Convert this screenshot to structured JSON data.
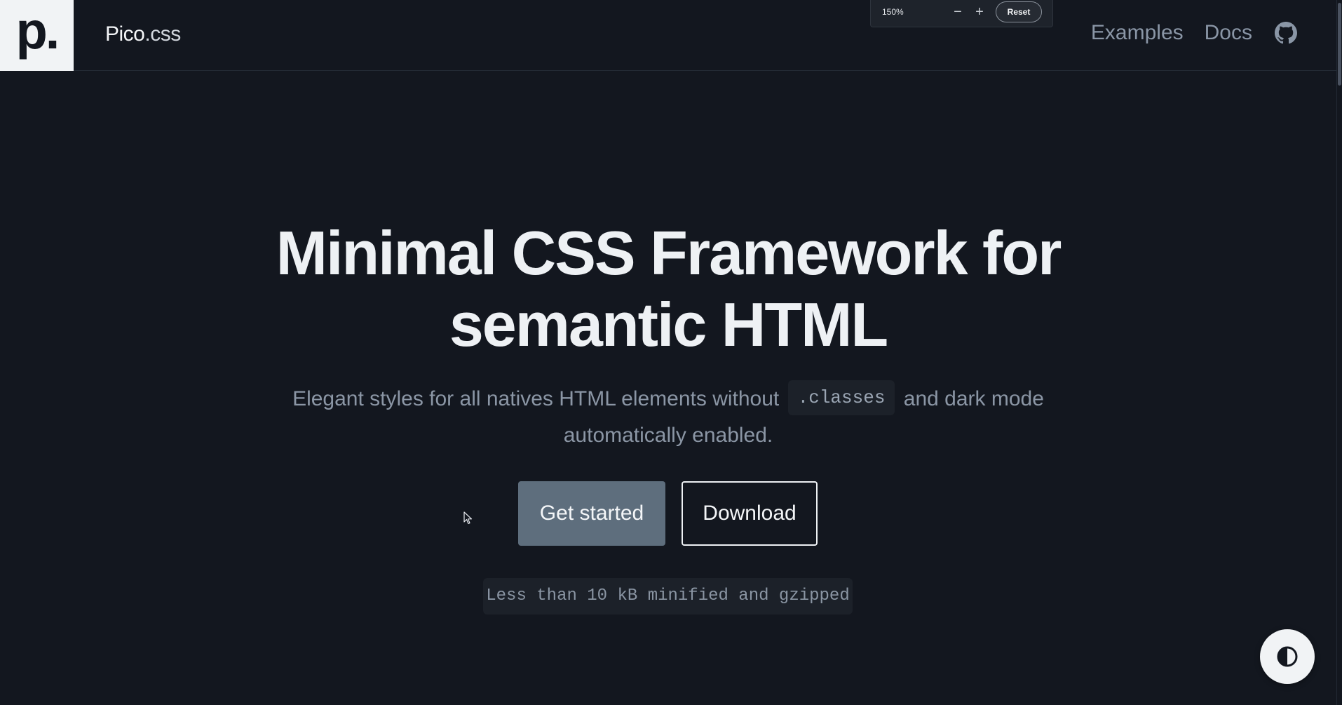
{
  "zoom": {
    "level": "150%",
    "minus": "−",
    "plus": "+",
    "reset_label": "Reset"
  },
  "header": {
    "logo": "p.",
    "brand_name": "Pico",
    "brand_suffix": ".css",
    "nav": [
      {
        "label": "Examples"
      },
      {
        "label": "Docs"
      }
    ],
    "github_icon": "github-icon"
  },
  "hero": {
    "title_line1": "Minimal CSS Framework for",
    "title_line2": "semantic HTML",
    "subtitle_before": "Elegant styles for all natives HTML elements without",
    "subtitle_code": ".classes",
    "subtitle_after": "and dark mode",
    "subtitle_line2": "automatically enabled.",
    "primary_button": "Get started",
    "secondary_button": "Download",
    "size_note": "Less than 10 kB minified and gzipped"
  },
  "theme_toggle_icon": "contrast-icon",
  "colors": {
    "background": "#13171f",
    "primary_button": "#5e6e7d",
    "text": "#eef1f4",
    "muted": "#8b96a5"
  }
}
